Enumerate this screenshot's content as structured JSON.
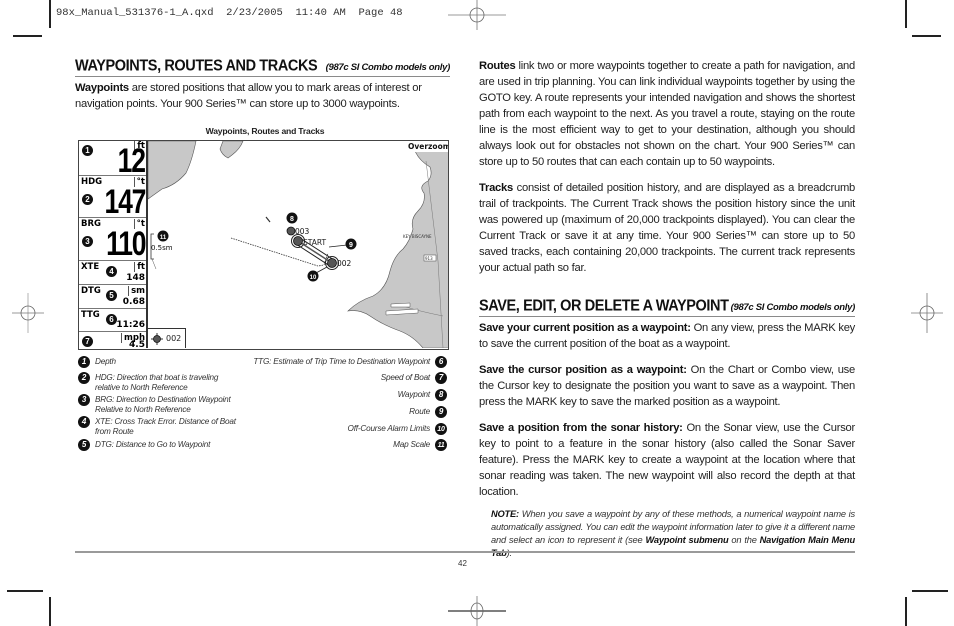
{
  "slug_line": "98x_Manual_531376-1_A.qxd  2/23/2005  11:40 AM  Page 48",
  "left": {
    "section_title": "WAYPOINTS, ROUTES AND TRACKS",
    "section_note": "(987c SI Combo models only)",
    "intro_bold": "Waypoints",
    "intro_text": " are stored positions that allow you to mark areas of interest or navigation points. Your 900 Series™ can store up to 3000 waypoints.",
    "figure_caption": "Waypoints, Routes and Tracks"
  },
  "screen": {
    "depth": {
      "marker": "1",
      "unit": "ft",
      "value": "12"
    },
    "hdg": {
      "label": "HDG",
      "marker": "2",
      "unit": "°t",
      "value": "147"
    },
    "brg": {
      "label": "BRG",
      "marker": "3",
      "unit": "°t",
      "value": "110"
    },
    "xte": {
      "label": "XTE",
      "marker": "4",
      "unit": "ft",
      "value": "148"
    },
    "dtg": {
      "label": "DTG",
      "marker": "5",
      "unit": "sm",
      "value": "0.68"
    },
    "ttg": {
      "label": "TTG",
      "marker": "6",
      "value": "11:26"
    },
    "speed": {
      "marker": "7",
      "unit": "mph",
      "value": "4.5"
    },
    "overzoom": "Overzoom",
    "scale_marker": "11",
    "scale_label": "0.5sm",
    "waypoint_marker": "8",
    "waypoint_003": "003",
    "route_marker": "9",
    "start_label": "START",
    "waypoint_002": "002",
    "alarm_marker": "10",
    "map_place": "KEY BISCAYNE",
    "map_road": "913",
    "nav_waypoint": "002"
  },
  "legend": {
    "left": [
      {
        "num": "1",
        "text": "Depth"
      },
      {
        "num": "2",
        "text": "HDG: Direction that boat is traveling relative to North Reference"
      },
      {
        "num": "3",
        "text": "BRG: Direction to Destination Waypoint Relative to North Reference"
      },
      {
        "num": "4",
        "text": "XTE: Cross Track Error.  Distance of Boat from Route"
      },
      {
        "num": "5",
        "text": "DTG: Distance to Go to Waypoint"
      }
    ],
    "right": [
      {
        "num": "6",
        "text": "TTG: Estimate of Trip Time to Destination Waypoint"
      },
      {
        "num": "7",
        "text": "Speed of Boat"
      },
      {
        "num": "8",
        "text": "Waypoint"
      },
      {
        "num": "9",
        "text": "Route"
      },
      {
        "num": "10",
        "text": "Off-Course Alarm Limits"
      },
      {
        "num": "11",
        "text": "Map Scale"
      }
    ]
  },
  "right": {
    "routes_bold": "Routes",
    "routes_text": " link two or more waypoints together to create a path for navigation, and are used in trip planning. You can link individual waypoints together by using the GOTO key. A route represents your intended navigation and shows the shortest path from each waypoint to the next. As you travel a route, staying on the route line is the most efficient way to get to your destination, although you should always look out for obstacles not shown on the chart. Your 900 Series™ can store up to 50 routes that can each contain up to 50 waypoints.",
    "tracks_bold": "Tracks",
    "tracks_text": " consist of detailed position history, and are displayed as a breadcrumb trail of trackpoints. The Current Track shows the position history since the unit was powered up (maximum of 20,000 trackpoints displayed). You can clear the Current Track or save it at any time. Your 900 Series™ can store up to 50 saved tracks, each containing 20,000 trackpoints. The current track represents your actual path so far.",
    "section_title": "SAVE, EDIT, OR DELETE A WAYPOINT",
    "section_note": "(987c SI Combo models only)",
    "p1_bold": "Save your current position as a waypoint:",
    "p1_text": " On any view, press the MARK key to save the current position of the boat as a waypoint.",
    "p2_bold": "Save the cursor position as a waypoint:",
    "p2_text": " On the Chart or Combo view, use the Cursor key to designate the position you want to save as a waypoint. Then press the MARK key to save the marked position as a waypoint.",
    "p3_bold": "Save a position from the sonar history:",
    "p3_text": " On the Sonar view, use the Cursor key to point to a feature in the sonar history (also called the Sonar Saver feature). Press the MARK key to create a waypoint at the location where that sonar reading was taken. The new waypoint will also record the depth at that location.",
    "note_bold": "NOTE:",
    "note_text_1": " When you save a waypoint by any of these methods, a numerical waypoint name is automatically assigned. You can edit the waypoint information later to give it a different name and select an icon to represent it (see ",
    "note_link_1": "Waypoint submenu",
    "note_text_2": " on the ",
    "note_link_2": "Navigation Main Menu Tab",
    "note_text_3": ")."
  },
  "footer": {
    "page_number": "42"
  }
}
